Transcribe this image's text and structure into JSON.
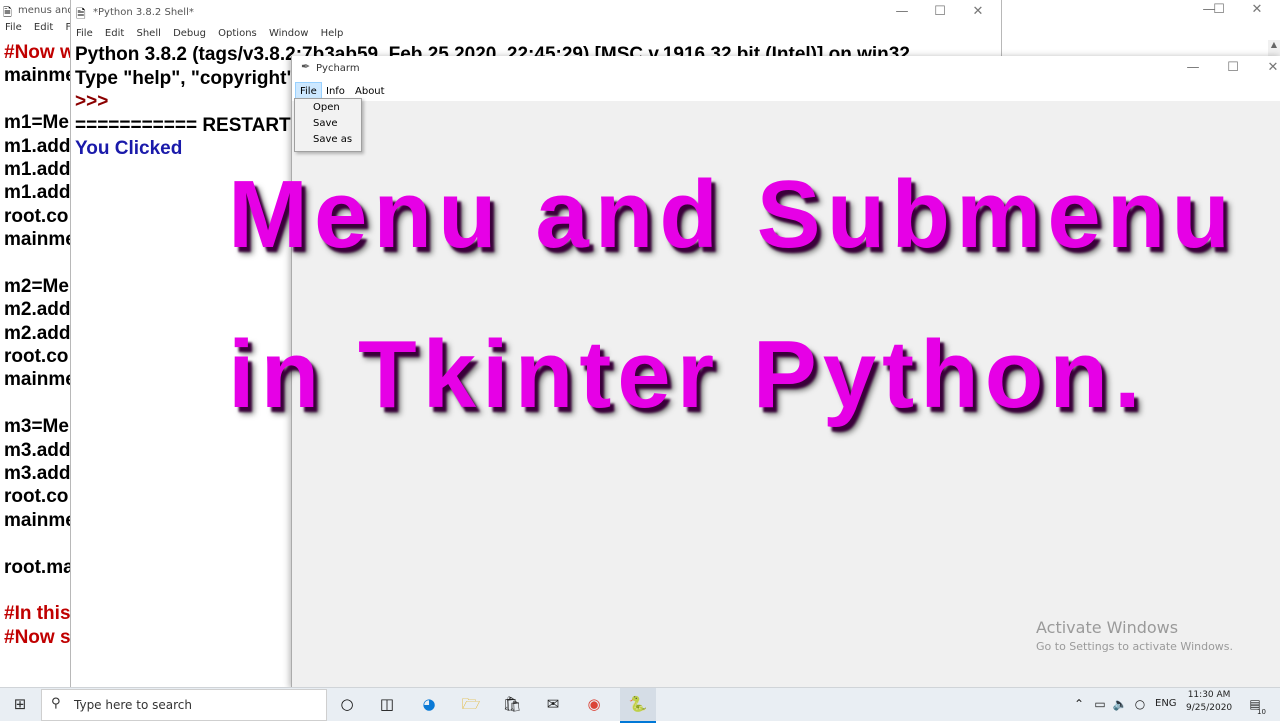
{
  "editor": {
    "title": "menus and",
    "menu": [
      "File",
      "Edit",
      "For"
    ],
    "code_lines": [
      {
        "text": "#Now w",
        "color": "red"
      },
      {
        "text": "mainme",
        "color": "black"
      },
      {
        "text": "",
        "color": "black"
      },
      {
        "text": "m1=Me",
        "color": "black"
      },
      {
        "text": "m1.add",
        "color": "black"
      },
      {
        "text": "m1.add",
        "color": "black"
      },
      {
        "text": "m1.add",
        "color": "black"
      },
      {
        "text": "root.co",
        "color": "black"
      },
      {
        "text": "mainme",
        "color": "black"
      },
      {
        "text": "",
        "color": "black"
      },
      {
        "text": "m2=Me",
        "color": "black"
      },
      {
        "text": "m2.add",
        "color": "black"
      },
      {
        "text": "m2.add",
        "color": "black"
      },
      {
        "text": "root.co",
        "color": "black"
      },
      {
        "text": "mainme",
        "color": "black"
      },
      {
        "text": "",
        "color": "black"
      },
      {
        "text": "m3=Me",
        "color": "black"
      },
      {
        "text": "m3.add",
        "color": "black"
      },
      {
        "text": "m3.add",
        "color": "black"
      },
      {
        "text": "root.co",
        "color": "black"
      },
      {
        "text": "mainme",
        "color": "black"
      },
      {
        "text": "",
        "color": "black"
      },
      {
        "text": "root.ma",
        "color": "black"
      },
      {
        "text": "",
        "color": "black"
      },
      {
        "text": "#In this",
        "color": "red"
      },
      {
        "text": "#Now s",
        "color": "red"
      }
    ]
  },
  "shell": {
    "title": "*Python 3.8.2 Shell*",
    "menu": [
      "File",
      "Edit",
      "Shell",
      "Debug",
      "Options",
      "Window",
      "Help"
    ],
    "line1": "Python 3.8.2 (tags/v3.8.2:7b3ab59, Feb 25 2020, 22:45:29) [MSC v.1916 32 bit (Intel)] on win32",
    "line2": "Type \"help\", \"copyright\"",
    "prompt": ">>>",
    "restart": "=========== RESTART",
    "output": "You Clicked"
  },
  "app": {
    "title": "Pycharm",
    "menu": [
      "File",
      "Info",
      "About"
    ],
    "file_menu_items": [
      "Open",
      "Save",
      "Save as"
    ]
  },
  "overlay": {
    "line1": "Menu and Submenu",
    "line2": "in Tkinter Python."
  },
  "watermark": {
    "title": "Activate Windows",
    "subtitle": "Go to Settings to activate Windows."
  },
  "taskbar": {
    "search_placeholder": "Type here to search",
    "language": "ENG",
    "time": "11:30 AM",
    "date": "9/25/2020",
    "notification_count": "10"
  },
  "colors": {
    "overlay_text": "#e600e6",
    "code_red": "#c00000",
    "shell_output": "#1a1aaa",
    "menu_highlight": "#cde8ff"
  }
}
